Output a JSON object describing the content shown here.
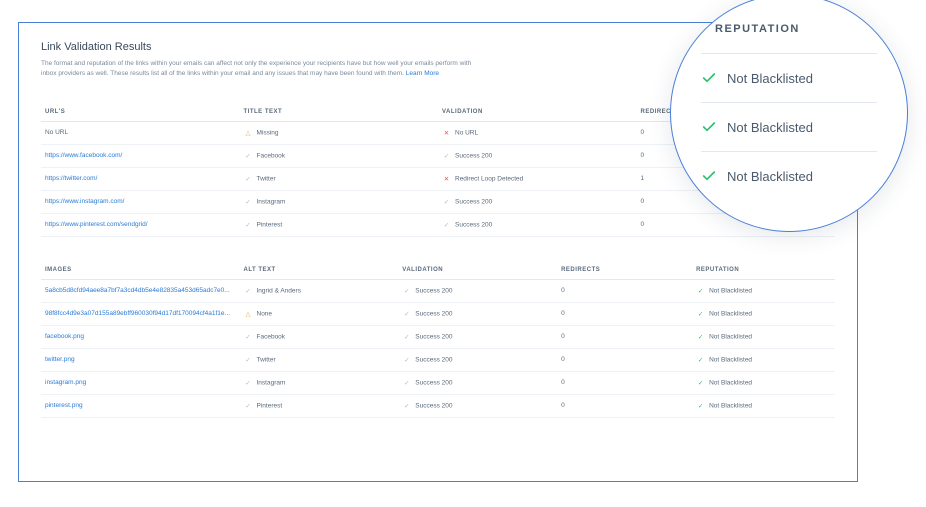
{
  "header": {
    "title": "Link Validation Results",
    "description_1": "The format and reputation of the links within your emails can affect not only the experience your recipients have but how well your emails perform with inbox providers as well. These results list all of the links within your email and any issues that may have been found with them. ",
    "learn_more": "Learn More"
  },
  "urls_table": {
    "columns": {
      "c1": "URL'S",
      "c2": "TITLE TEXT",
      "c3": "VALIDATION",
      "c4": "REDIRECTS"
    },
    "rows": [
      {
        "url": "No URL",
        "url_is_link": false,
        "title": "Missing",
        "title_status": "warn",
        "validation": "No URL",
        "validation_status": "err",
        "redirects": "0"
      },
      {
        "url": "https://www.facebook.com/",
        "url_is_link": true,
        "title": "Facebook",
        "title_status": "ok",
        "validation": "Success 200",
        "validation_status": "ok",
        "redirects": "0"
      },
      {
        "url": "https://twitter.com/",
        "url_is_link": true,
        "title": "Twitter",
        "title_status": "ok",
        "validation": "Redirect Loop Detected",
        "validation_status": "err",
        "redirects": "1"
      },
      {
        "url": "https://www.instagram.com/",
        "url_is_link": true,
        "title": "Instagram",
        "title_status": "ok",
        "validation": "Success 200",
        "validation_status": "ok",
        "redirects": "0"
      },
      {
        "url": "https://www.pinterest.com/sendgrid/",
        "url_is_link": true,
        "title": "Pinterest",
        "title_status": "ok",
        "validation": "Success 200",
        "validation_status": "ok",
        "redirects": "0"
      }
    ]
  },
  "images_table": {
    "columns": {
      "c1": "IMAGES",
      "c2": "ALT TEXT",
      "c3": "VALIDATION",
      "c4": "REDIRECTS",
      "c5": "REPUTATION"
    },
    "rows": [
      {
        "image": "5a8cb5d8cfd94aee8a7bf7a3cd4db5e4e82835a453d65adc7e0...",
        "alt": "Ingrid & Anders",
        "alt_status": "ok",
        "validation": "Success 200",
        "validation_status": "ok",
        "redirects": "0",
        "reputation": "Not Blacklisted",
        "reputation_status": "okg"
      },
      {
        "image": "98f8fcc4d9e3a07d155a89ebff960030f94d17df170094cf4a1f1e...",
        "alt": "None",
        "alt_status": "warn",
        "validation": "Success 200",
        "validation_status": "ok",
        "redirects": "0",
        "reputation": "Not Blacklisted",
        "reputation_status": "okg"
      },
      {
        "image": "facebook.png",
        "alt": "Facebook",
        "alt_status": "ok",
        "validation": "Success 200",
        "validation_status": "ok",
        "redirects": "0",
        "reputation": "Not Blacklisted",
        "reputation_status": "okg"
      },
      {
        "image": "twitter.png",
        "alt": "Twitter",
        "alt_status": "ok",
        "validation": "Success 200",
        "validation_status": "ok",
        "redirects": "0",
        "reputation": "Not Blacklisted",
        "reputation_status": "okg"
      },
      {
        "image": "instagram.png",
        "alt": "Instagram",
        "alt_status": "ok",
        "validation": "Success 200",
        "validation_status": "ok",
        "redirects": "0",
        "reputation": "Not Blacklisted",
        "reputation_status": "okg"
      },
      {
        "image": "pinterest.png",
        "alt": "Pinterest",
        "alt_status": "ok",
        "validation": "Success 200",
        "validation_status": "ok",
        "redirects": "0",
        "reputation": "Not Blacklisted",
        "reputation_status": "okg"
      }
    ]
  },
  "magnifier": {
    "heading": "REPUTATION",
    "rows": [
      {
        "label": "Not Blacklisted"
      },
      {
        "label": "Not Blacklisted"
      },
      {
        "label": "Not Blacklisted"
      }
    ]
  }
}
